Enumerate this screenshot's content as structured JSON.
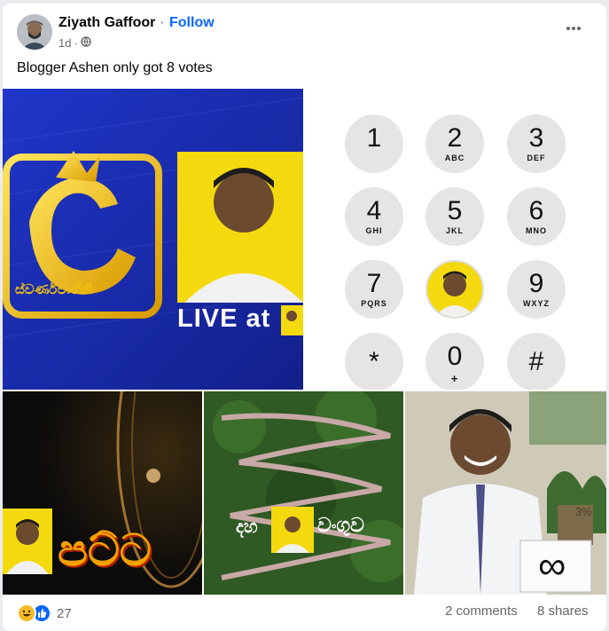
{
  "post": {
    "author": "Ziyath Gaffoor",
    "follow_label": "Follow",
    "separator": "·",
    "time": "1d",
    "meta_dot": "·",
    "privacy_icon": "globe-icon",
    "caption": "Blogger Ashen only got 8 votes"
  },
  "images": {
    "tv": {
      "logo_text": "ස්වර්ණවාහිනී",
      "live_text": "LIVE at"
    },
    "dialpad": {
      "keys": [
        {
          "digit": "1",
          "letters": ""
        },
        {
          "digit": "2",
          "letters": "ABC"
        },
        {
          "digit": "3",
          "letters": "DEF"
        },
        {
          "digit": "4",
          "letters": "GHI"
        },
        {
          "digit": "5",
          "letters": "JKL"
        },
        {
          "digit": "6",
          "letters": "MNO"
        },
        {
          "digit": "7",
          "letters": "PQRS"
        },
        {
          "digit": "",
          "letters": ""
        },
        {
          "digit": "9",
          "letters": "WXYZ"
        },
        {
          "digit": "*",
          "letters": ""
        },
        {
          "digit": "0",
          "letters": "+"
        },
        {
          "digit": "#",
          "letters": ""
        }
      ]
    },
    "space": {
      "text": "පට්ට"
    },
    "road": {
      "left_text": "දහ",
      "right_text": "වංගුව"
    },
    "school": {
      "badge": "3%",
      "sign_symbol": "∞"
    }
  },
  "footer": {
    "reactions": [
      "haha-icon",
      "like-icon"
    ],
    "reaction_count": "27",
    "comments": "2 comments",
    "shares": "8 shares"
  },
  "colors": {
    "accent": "#0866ff",
    "muted": "#65676b",
    "tv_blue": "#1b2fa8",
    "gold": "#f2c10d"
  }
}
